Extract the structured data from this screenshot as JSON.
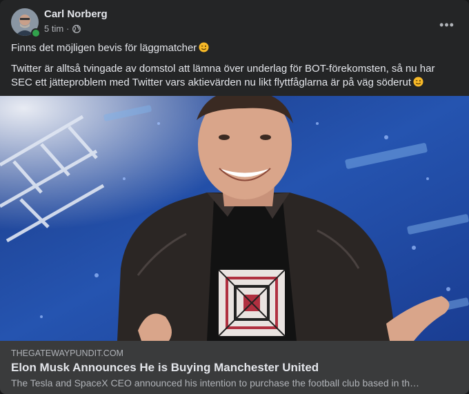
{
  "post": {
    "author": "Carl Norberg",
    "time": "5 tim",
    "separator": "·",
    "audience_icon": "globe-icon",
    "more_icon": "more-options-icon",
    "more_label": "•••",
    "paragraphs": [
      "Finns det möjligen bevis för läggmatcher",
      "Twitter är alltså tvingade av domstol att lämna över underlag för BOT-förekomsten, så nu har SEC ett jätteproblem med Twitter vars aktievärden nu likt flyttfåglarna är på väg söderut"
    ],
    "emoji": "winking-face-emoji"
  },
  "link_preview": {
    "domain": "THEGATEWAYPUNDIT.COM",
    "title": "Elon Musk Announces He is Buying Manchester United",
    "description": "The Tesla and SpaceX CEO announced his intention to purchase the football club based in th…"
  },
  "colors": {
    "card_bg": "#242526",
    "link_bg": "#3a3b3c",
    "primary_text": "#e4e6eb",
    "secondary_text": "#b0b3b8",
    "online": "#31a24c"
  }
}
